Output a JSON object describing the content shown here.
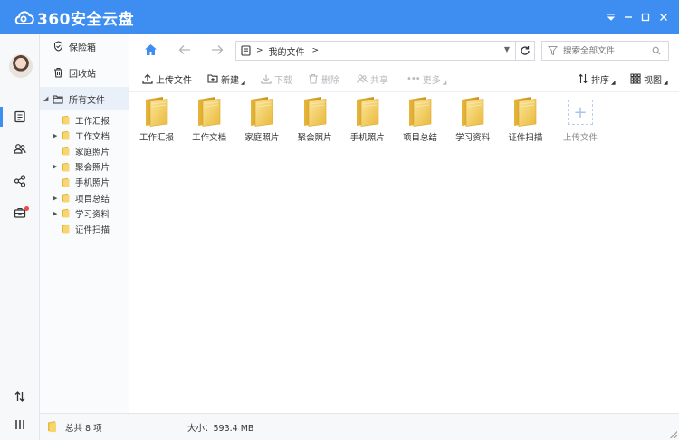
{
  "app": {
    "title": "360安全云盘"
  },
  "sidebar": {
    "items": [
      {
        "label": "保险箱"
      },
      {
        "label": "回收站"
      },
      {
        "label": "所有文件"
      }
    ],
    "tree": [
      {
        "label": "工作汇报",
        "expandable": false
      },
      {
        "label": "工作文档",
        "expandable": true
      },
      {
        "label": "家庭照片",
        "expandable": false
      },
      {
        "label": "聚会照片",
        "expandable": true
      },
      {
        "label": "手机照片",
        "expandable": false
      },
      {
        "label": "项目总结",
        "expandable": true
      },
      {
        "label": "学习资料",
        "expandable": true
      },
      {
        "label": "证件扫描",
        "expandable": false
      }
    ]
  },
  "nav": {
    "breadcrumb": "我的文件",
    "search_placeholder": "搜索全部文件"
  },
  "toolbar": {
    "upload": "上传文件",
    "new": "新建",
    "download": "下载",
    "delete": "删除",
    "share": "共享",
    "more": "更多",
    "sort": "排序",
    "view": "视图"
  },
  "files": [
    {
      "name": "工作汇报"
    },
    {
      "name": "工作文档"
    },
    {
      "name": "家庭照片"
    },
    {
      "name": "聚会照片"
    },
    {
      "name": "手机照片"
    },
    {
      "name": "项目总结"
    },
    {
      "name": "学习资料"
    },
    {
      "name": "证件扫描"
    }
  ],
  "upload_tile": {
    "label": "上传文件"
  },
  "status": {
    "count": "总共 8 项",
    "size": "大小：593.4 MB"
  },
  "colors": {
    "accent": "#3d8ef0",
    "folder": "#f0c443"
  }
}
